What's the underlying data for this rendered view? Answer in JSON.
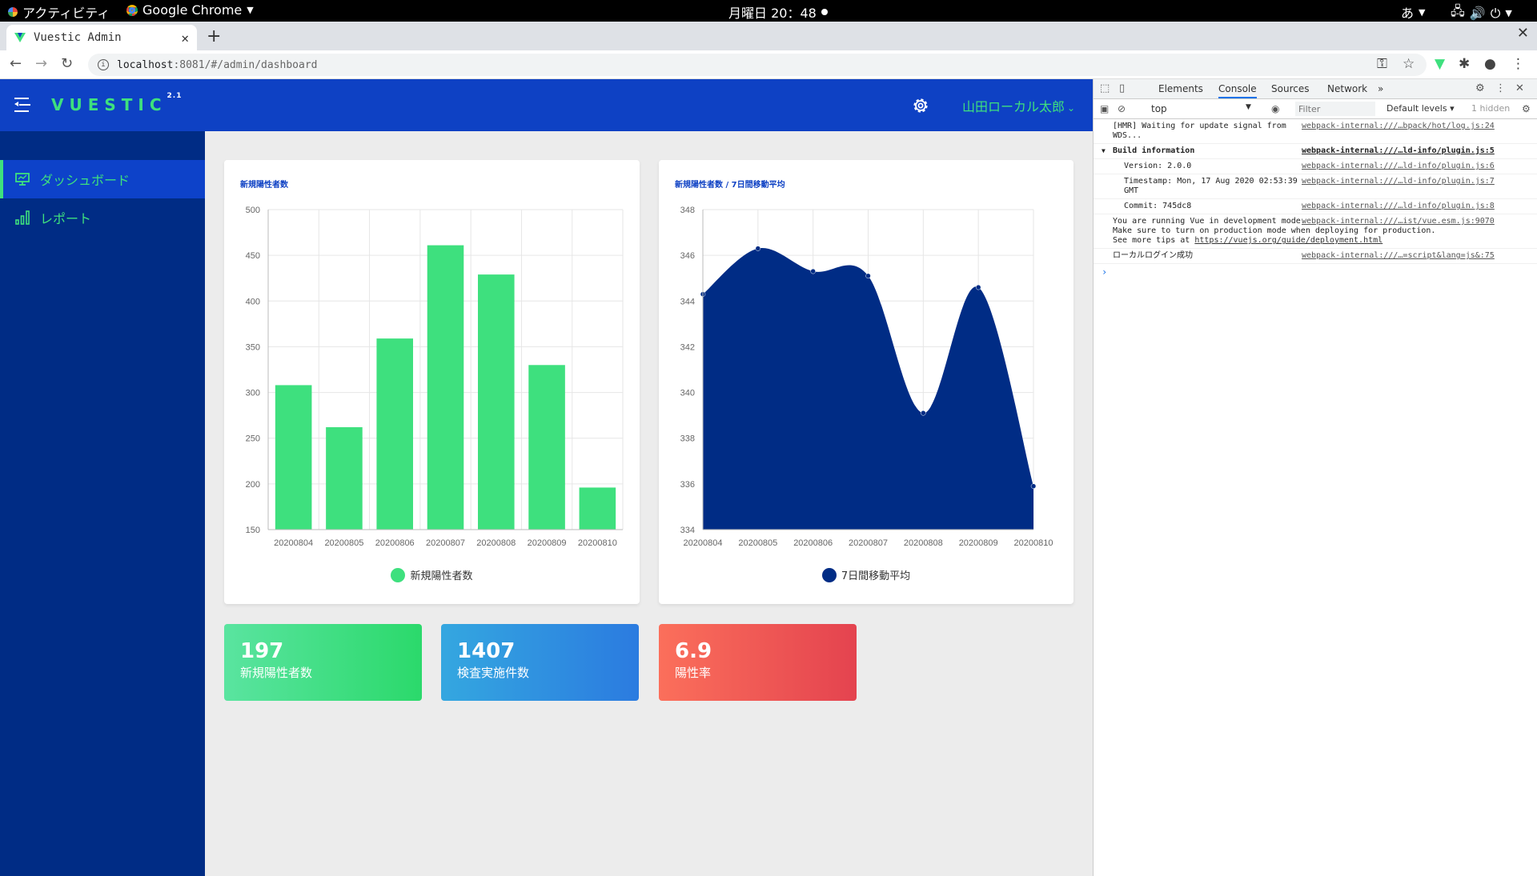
{
  "os_bar": {
    "activities": "アクティビティ",
    "app_name": "Google Chrome",
    "clock": "月曜日 20：48",
    "input_method": "あ"
  },
  "browser": {
    "tab_title": "Vuestic Admin",
    "url_host": "localhost",
    "url_rest": ":8081/#/admin/dashboard"
  },
  "app": {
    "logo": "VUESTIC",
    "logo_version": "2.1",
    "user_name": "山田ローカル太郎",
    "sidebar": {
      "items": [
        {
          "label": "ダッシュボード",
          "icon": "monitor-icon",
          "active": true
        },
        {
          "label": "レポート",
          "icon": "bar-signal-icon",
          "active": false
        }
      ]
    },
    "stats": [
      {
        "value": "197",
        "label": "新規陽性者数",
        "colors": [
          "#5ae4a0",
          "#2bd96b"
        ]
      },
      {
        "value": "1407",
        "label": "検査実施件数",
        "colors": [
          "#34a7e0",
          "#2b7be0"
        ]
      },
      {
        "value": "6.9",
        "label": "陽性率",
        "colors": [
          "#fb6f5b",
          "#e4434f"
        ]
      }
    ]
  },
  "colors": {
    "header": "#0e41c4",
    "sidebar": "#002c85",
    "accent_green": "#3ee07e",
    "area_fill": "#002c85"
  },
  "chart_data": [
    {
      "type": "bar",
      "title": "新規陽性者数",
      "categories": [
        "20200804",
        "20200805",
        "20200806",
        "20200807",
        "20200808",
        "20200809",
        "20200810"
      ],
      "series": [
        {
          "name": "新規陽性者数",
          "values": [
            308,
            262,
            359,
            461,
            429,
            330,
            196
          ]
        }
      ],
      "ylim": [
        150,
        500
      ],
      "yticks": [
        150,
        200,
        250,
        300,
        350,
        400,
        450,
        500
      ],
      "grid": true,
      "legend": "bottom",
      "color": "#3ee07e"
    },
    {
      "type": "area",
      "title": "新規陽性者数 / 7日間移動平均",
      "categories": [
        "20200804",
        "20200805",
        "20200806",
        "20200807",
        "20200808",
        "20200809",
        "20200810"
      ],
      "series": [
        {
          "name": "7日間移動平均",
          "values": [
            344.3,
            346.3,
            345.3,
            345.1,
            339.1,
            344.6,
            335.9
          ]
        }
      ],
      "ylim": [
        334,
        348
      ],
      "yticks": [
        334,
        336,
        338,
        340,
        342,
        344,
        346,
        348
      ],
      "grid": true,
      "legend": "bottom",
      "color": "#002c85"
    }
  ],
  "devtools": {
    "tabs": [
      "Elements",
      "Console",
      "Sources",
      "Network"
    ],
    "active_tab": "Console",
    "more": "»",
    "context": "top",
    "filter_placeholder": "Filter",
    "levels": "Default levels ▾",
    "hidden": "1 hidden",
    "logs": [
      {
        "msg": "[HMR] Waiting for update signal from WDS...",
        "src": "webpack-internal:///…bpack/hot/log.js:24"
      },
      {
        "msg": "Build information",
        "src": "webpack-internal:///…ld-info/plugin.js:5",
        "group": true
      },
      {
        "msg": "Version: 2.0.0",
        "src": "webpack-internal:///…ld-info/plugin.js:6",
        "indent": true
      },
      {
        "msg": "Timestamp: Mon, 17 Aug 2020 02:53:39 GMT",
        "src": "webpack-internal:///…ld-info/plugin.js:7",
        "indent": true
      },
      {
        "msg": "Commit: 745dc8",
        "src": "webpack-internal:///…ld-info/plugin.js:8",
        "indent": true
      },
      {
        "msg": "You are running Vue in development mode.\nMake sure to turn on production mode when deploying for production.\nSee more tips at ",
        "link": "https://vuejs.org/guide/deployment.html",
        "src": "webpack-internal:///…ist/vue.esm.js:9070"
      },
      {
        "msg": "ローカルログイン成功",
        "src": "webpack-internal:///…=script&lang=js&:75"
      }
    ],
    "prompt": "›"
  }
}
